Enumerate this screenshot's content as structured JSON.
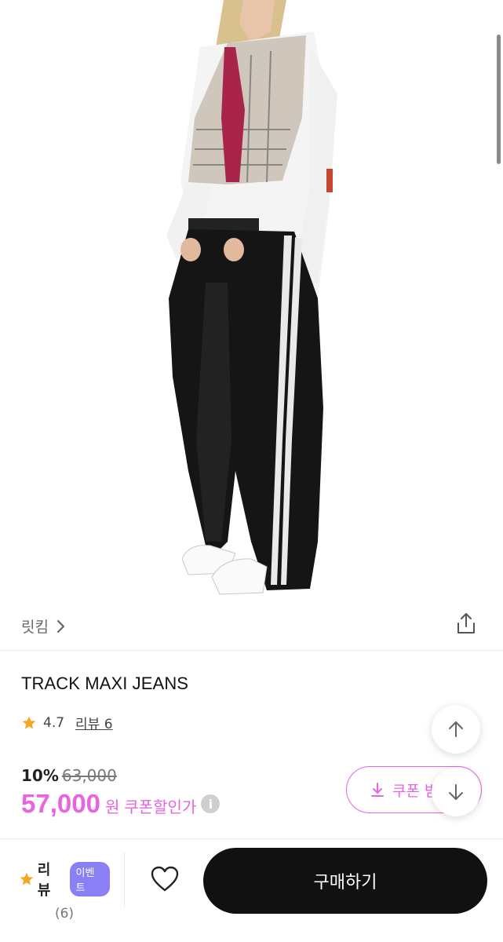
{
  "product_image": {
    "alt": "model wearing black track jeans with white side stripes"
  },
  "brand": {
    "name": "릿킴",
    "arrow": "›"
  },
  "product": {
    "title": "TRACK MAXI JEANS",
    "rating": "4.7",
    "review_label": "리뷰 6",
    "discount_pct": "10%",
    "original_price": "63,000",
    "price": "57,000",
    "currency": "원",
    "coupon_note": "쿠폰할인가",
    "info": "i"
  },
  "coupon_button": {
    "label": "쿠폰 받"
  },
  "bottom_bar": {
    "review_label": "리뷰",
    "event_badge": "이벤트",
    "review_count": "(6)",
    "buy_label": "구매하기"
  },
  "colors": {
    "accent": "#e864e0",
    "badge": "#8b7ff5",
    "star": "#f5a623",
    "dark": "#111111"
  },
  "icons": [
    "share-icon",
    "star-icon",
    "arrow-up-icon",
    "arrow-down-icon",
    "download-icon",
    "heart-icon",
    "info-icon",
    "chevron-right-icon"
  ]
}
